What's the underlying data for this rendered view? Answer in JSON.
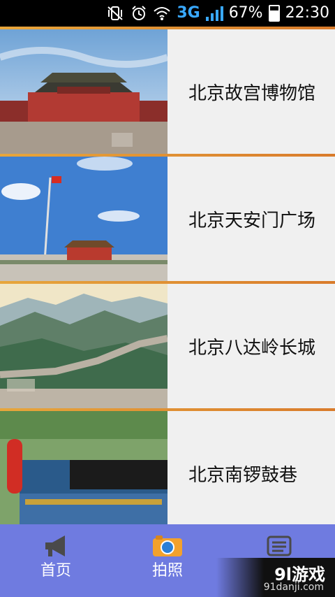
{
  "status": {
    "battery": "67%",
    "time": "22:30",
    "network": "3G"
  },
  "items": [
    {
      "label": "北京故宫博物馆"
    },
    {
      "label": "北京天安门广场"
    },
    {
      "label": "北京八达岭长城"
    },
    {
      "label": "北京南锣鼓巷"
    }
  ],
  "bottom_nav": {
    "tabs": [
      {
        "label": "首页",
        "icon": "megaphone-icon"
      },
      {
        "label": "拍照",
        "icon": "camera-icon"
      },
      {
        "label": "",
        "icon": "list-icon"
      }
    ]
  },
  "watermark": {
    "brand": "9l游戏",
    "site": "91danji.com"
  },
  "colors": {
    "status_bar": "#000000",
    "bottom_nav": "#6f7be0",
    "divider": "#e29a35",
    "row_bg": "#f0f0f0"
  }
}
